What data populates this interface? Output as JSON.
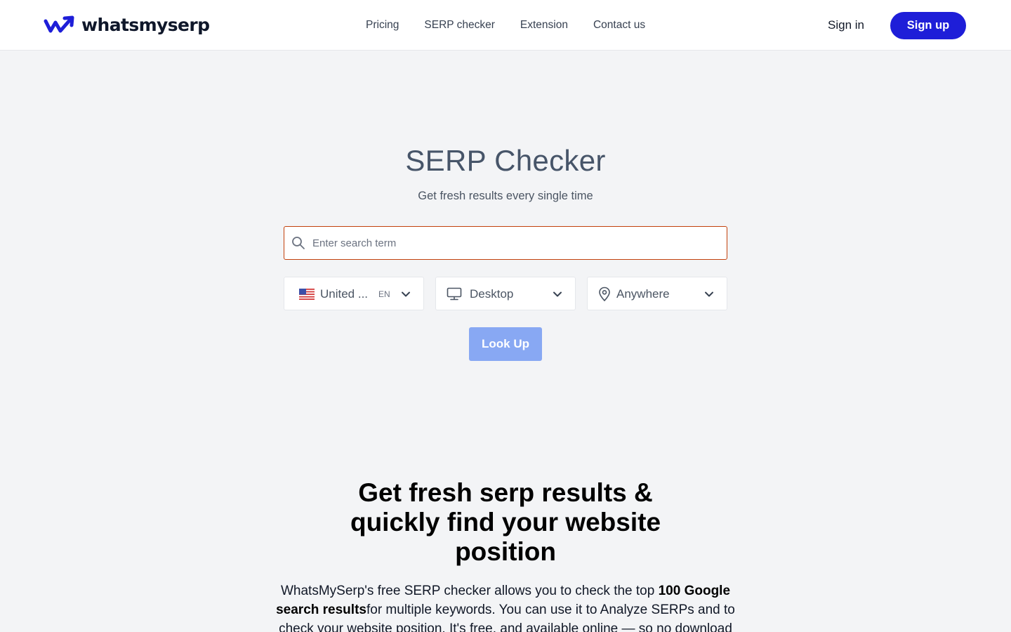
{
  "header": {
    "logo_text": "whatsmyserp",
    "nav": [
      "Pricing",
      "SERP checker",
      "Extension",
      "Contact us"
    ],
    "sign_in": "Sign in",
    "sign_up": "Sign up"
  },
  "hero": {
    "title": "SERP Checker",
    "subtitle": "Get fresh results every single time",
    "search": {
      "placeholder": "Enter search term",
      "value": ""
    },
    "country": {
      "label": "United ...",
      "lang": "EN",
      "icon": "us-flag-icon"
    },
    "device": {
      "label": "Desktop",
      "icon": "desktop-icon"
    },
    "location": {
      "label": "Anywhere",
      "icon": "map-pin-icon"
    },
    "lookup_label": "Look Up"
  },
  "section": {
    "title": "Get fresh serp results & quickly find your website position",
    "text_1": "WhatsMySerp's free SERP checker allows you to check the top ",
    "text_bold_1": "100 Google search results",
    "text_2": "for multiple keywords. You can use it to Analyze SERPs and to check your website position. It's free, and available online — so no download"
  },
  "colors": {
    "brand": "#1e1ed8",
    "lookup_button": "#88a8f3",
    "search_border": "#c2410c",
    "background": "#f3f4f6"
  }
}
